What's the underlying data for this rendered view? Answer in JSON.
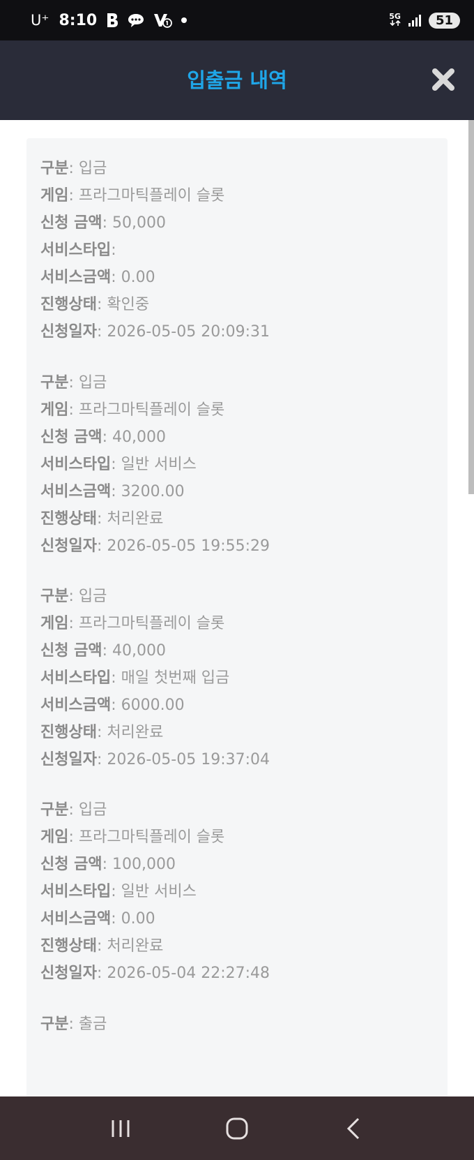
{
  "status_bar": {
    "carrier": "U⁺",
    "time": "8:10",
    "network": "5G",
    "battery": "51"
  },
  "header": {
    "title": "입출금 내역"
  },
  "labels": {
    "type": "구분",
    "game": "게임",
    "amount": "신청 금액",
    "service_type": "서비스타입",
    "service_amount": "서비스금액",
    "status": "진행상태",
    "date": "신청일자",
    "sep": ": "
  },
  "records": [
    {
      "type": "입금",
      "game": "프라그마틱플레이 슬롯",
      "amount": "50,000",
      "service_type": "",
      "service_amount": "0.00",
      "status": "확인중",
      "date": "2026-05-05 20:09:31"
    },
    {
      "type": "입금",
      "game": "프라그마틱플레이 슬롯",
      "amount": "40,000",
      "service_type": "일반 서비스",
      "service_amount": "3200.00",
      "status": "처리완료",
      "date": "2026-05-05 19:55:29"
    },
    {
      "type": "입금",
      "game": "프라그마틱플레이 슬롯",
      "amount": "40,000",
      "service_type": "매일 첫번째 입금",
      "service_amount": "6000.00",
      "status": "처리완료",
      "date": "2026-05-05 19:37:04"
    },
    {
      "type": "입금",
      "game": "프라그마틱플레이 슬롯",
      "amount": "100,000",
      "service_type": "일반 서비스",
      "service_amount": "0.00",
      "status": "처리완료",
      "date": "2026-05-04 22:27:48"
    },
    {
      "type": "출금"
    }
  ]
}
